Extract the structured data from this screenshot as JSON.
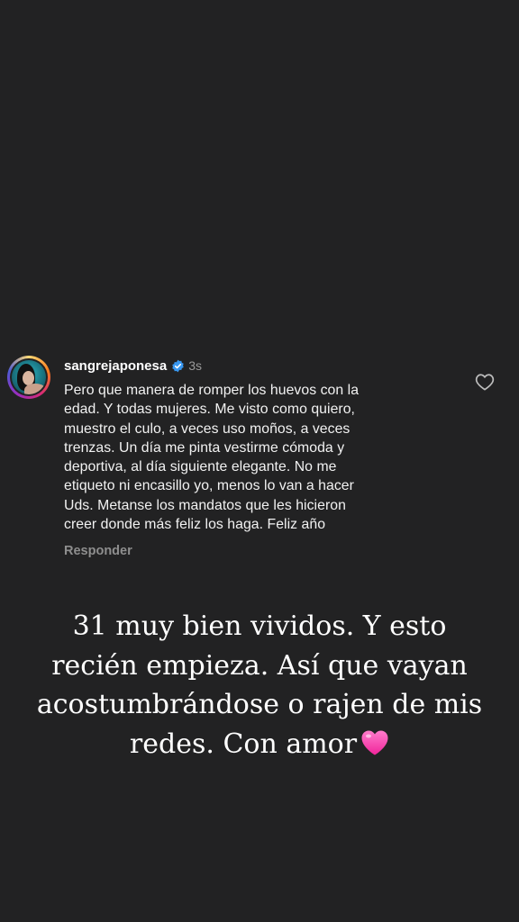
{
  "comment": {
    "username": "sangrejaponesa",
    "time": "3s",
    "text_lines": [
      "Pero que manera de romper los huevos con la",
      "edad. Y todas mujeres. Me visto como quiero,",
      "muestro el culo, a veces uso moños, a veces",
      "trenzas. Un día me pinta vestirme cómoda y",
      "deportiva, al día siguiente elegante. No me",
      "etiqueto ni encasillo yo, menos lo van a hacer",
      "Uds. Metanse los mandatos que les hicieron",
      "creer donde más feliz los haga. Feliz año"
    ],
    "reply_label": "Responder",
    "verified_icon": "verified-badge-icon",
    "like_icon": "heart-outline-icon"
  },
  "caption": {
    "lines": [
      "31 muy bien vividos. Y esto",
      "recién empieza. Así que vayan",
      "acostumbrándose o rajen de mis",
      "redes. Con amor"
    ],
    "emoji": "pink-heart-icon"
  },
  "colors": {
    "background": "#222223",
    "verified_blue": "#3897f0",
    "muted_text": "#8e8e8e",
    "heart_pink": "#ff4fb5"
  }
}
